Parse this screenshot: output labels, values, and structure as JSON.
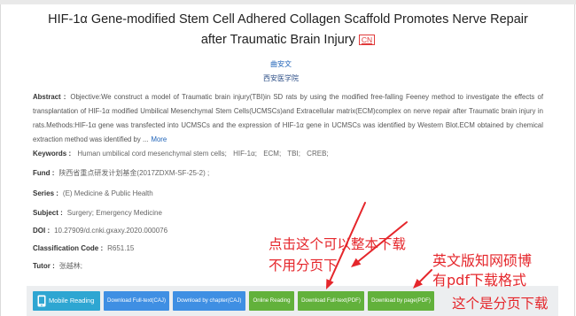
{
  "paper": {
    "title": "HIF-1α Gene-modified Stem Cell Adhered Collagen Scaffold Promotes Nerve Repair after Traumatic Brain Injury",
    "language_badge": "CN",
    "author": "曲安文",
    "institution": "西安医学院"
  },
  "abstract": {
    "label": "Abstract :",
    "text": "Objective:We construct a model of Traumatic brain injury(TBI)in SD rats by using the modified free-falling Feeney method to investigate the effects of transplantation of HIF-1α modified Umbilical Mesenchymal Stem Cells(UCMSCs)and Extracellular matrix(ECM)complex on nerve repair after Traumatic brain injury in rats.Methods:HIF-1α gene was transfected into UCMSCs and the expression of HIF-1α gene in UCMSCs was identified by Western Blot.ECM obtained by chemical extraction method was identified by ...",
    "more_link": "More"
  },
  "details": {
    "keywords": {
      "label": "Keywords :",
      "items": [
        "Human umbilical cord mesenchymal stem cells;",
        "HIF-1α;",
        "ECM;",
        "TBI;",
        "CREB;"
      ]
    },
    "fund": {
      "label": "Fund :",
      "value": "陕西省重点研发计划基金(2017ZDXM-SF-25-2) ;"
    },
    "series": {
      "label": "Series :",
      "value": "(E) Medicine & Public Health"
    },
    "subject": {
      "label": "Subject :",
      "value": "Surgery; Emergency Medicine"
    },
    "doi": {
      "label": "DOI :",
      "value": "10.27909/d.cnki.gxaxy.2020.000076"
    },
    "classification": {
      "label": "Classification Code :",
      "value": "R651.15"
    },
    "tutor": {
      "label": "Tutor :",
      "value": "张越林;"
    }
  },
  "actions": [
    {
      "label": "Mobile Reading",
      "icon": "mobile-phone-icon",
      "color": "#2ea6d2"
    },
    {
      "label": "Download Full-text(CAJ)",
      "color": "#3f8fe3"
    },
    {
      "label": "Download by chapter(CAJ)",
      "color": "#3f8fe3"
    },
    {
      "label": "Online Reading",
      "color": "#62b13b"
    },
    {
      "label": "Download Full-text(PDF)",
      "color": "#62b13b"
    },
    {
      "label": "Download by page(PDF)",
      "color": "#62b13b"
    }
  ],
  "annotations": {
    "color": "#e5262b",
    "full_download_note": [
      "点击这个可以整本下载",
      "不用分页下"
    ],
    "pdf_format_note": [
      "英文版知网硕博",
      "有pdf下载格式"
    ],
    "page_download_note": "这个是分页下载"
  },
  "colors": {
    "link": "#1f63b8",
    "badge": "#e03a3a"
  }
}
